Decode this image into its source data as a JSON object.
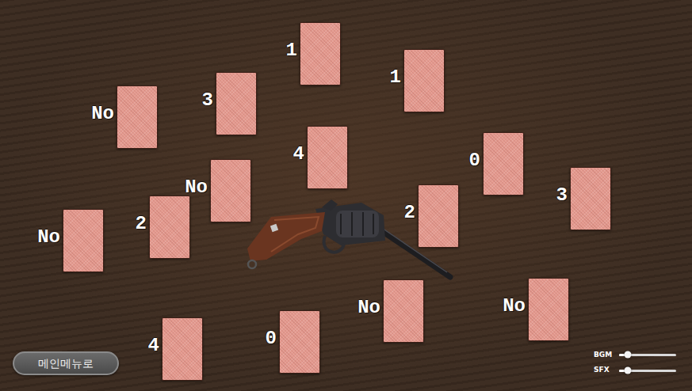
{
  "cards": [
    {
      "label": "1"
    },
    {
      "label": "1"
    },
    {
      "label": "No"
    },
    {
      "label": "3"
    },
    {
      "label": "4"
    },
    {
      "label": "0"
    },
    {
      "label": "3"
    },
    {
      "label": "No"
    },
    {
      "label": "2"
    },
    {
      "label": "2"
    },
    {
      "label": "No"
    },
    {
      "label": "No"
    },
    {
      "label": "No"
    },
    {
      "label": "4"
    },
    {
      "label": "0"
    }
  ],
  "menu_button": "메인메뉴로",
  "sliders": [
    {
      "label": "BGM",
      "level": 0.15
    },
    {
      "label": "SFX",
      "level": 0.15
    }
  ]
}
